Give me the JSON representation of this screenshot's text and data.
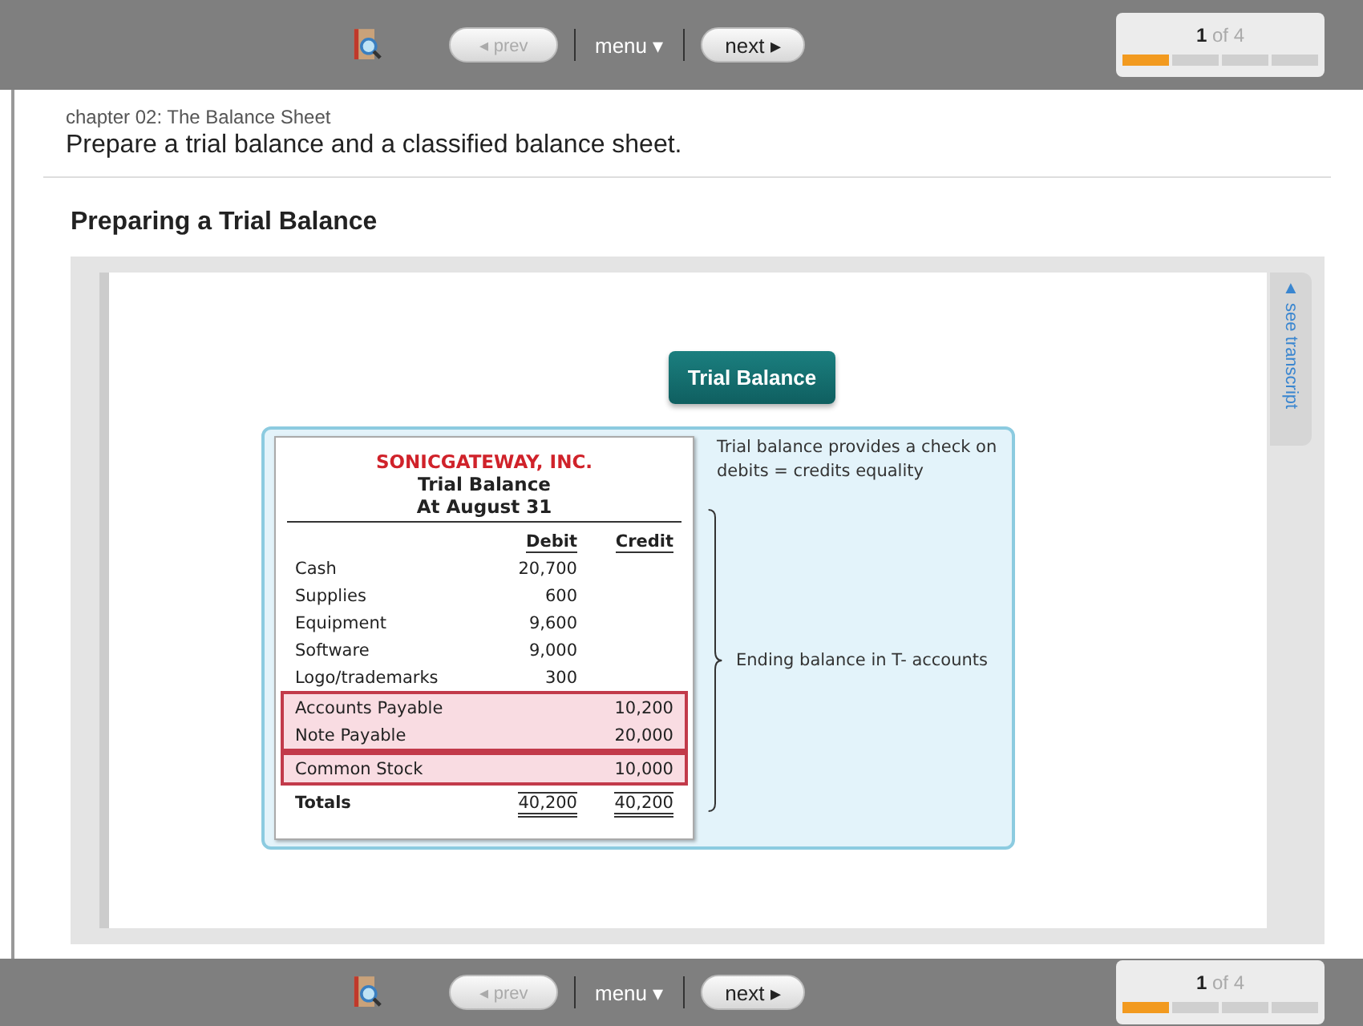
{
  "top_nav": {
    "prev": {
      "label": "◂ prev",
      "disabled": true
    },
    "menu": "menu ▾",
    "next": "next ▸",
    "progress": {
      "current": "1",
      "of": "of 4",
      "segments": [
        {
          "filled": true
        },
        {
          "filled": false
        },
        {
          "filled": false
        },
        {
          "filled": false
        }
      ]
    }
  },
  "header": {
    "chapter": "chapter 02: The Balance Sheet",
    "objective": "Prepare a trial balance and a classified balance sheet."
  },
  "section_title": "Preparing a Trial Balance",
  "slide": {
    "button": "Trial Balance",
    "transcript_tab": "▲ see transcript",
    "statement": {
      "company": "SONICGATEWAY, INC.",
      "title": "Trial Balance",
      "date": "At August 31",
      "columns": [
        "Debit",
        "Credit"
      ],
      "sections": [
        {
          "highlighted": false,
          "rows": [
            {
              "account": "Cash",
              "debit": "20,700",
              "credit": ""
            },
            {
              "account": "Supplies",
              "debit": "600",
              "credit": ""
            },
            {
              "account": "Equipment",
              "debit": "9,600",
              "credit": ""
            },
            {
              "account": "Software",
              "debit": "9,000",
              "credit": ""
            },
            {
              "account": "Logo/trademarks",
              "debit": "300",
              "credit": ""
            }
          ]
        },
        {
          "highlighted": true,
          "rows": [
            {
              "account": "Accounts Payable",
              "debit": "",
              "credit": "10,200"
            },
            {
              "account": "Note Payable",
              "debit": "",
              "credit": "20,000"
            }
          ]
        },
        {
          "highlighted": true,
          "rows": [
            {
              "account": "Common Stock",
              "debit": "",
              "credit": "10,000"
            }
          ]
        }
      ],
      "totals": {
        "label": "Totals",
        "debit": "40,200",
        "credit": "40,200"
      }
    },
    "note_top": "Trial balance provides a check on debits = credits  equality",
    "note_bracket": "Ending balance  in T- accounts"
  },
  "bottom_nav": {
    "prev": {
      "label": "◂ prev",
      "disabled": true
    },
    "menu": "menu ▾",
    "next": "next ▸",
    "progress": {
      "current": "1",
      "of": "of 4",
      "segments": [
        {
          "filled": true
        },
        {
          "filled": false
        },
        {
          "filled": false
        },
        {
          "filled": false
        }
      ]
    }
  }
}
